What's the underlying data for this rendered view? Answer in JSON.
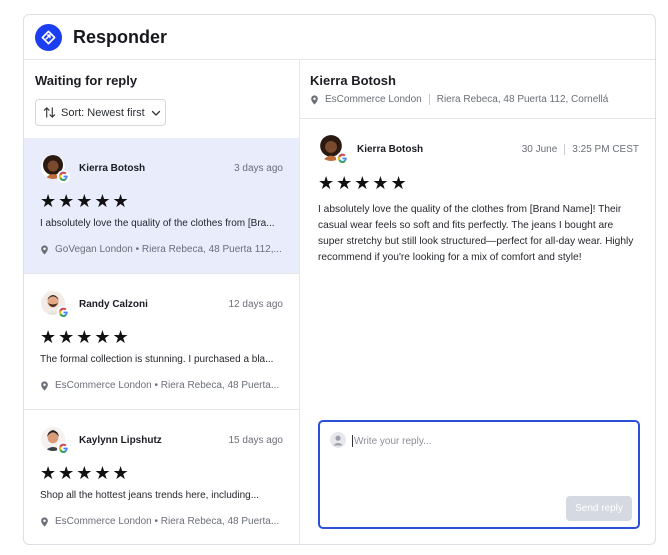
{
  "app": {
    "title": "Responder",
    "accent": "#1a3ef0"
  },
  "left_panel": {
    "title": "Waiting for reply",
    "sort_label": "Sort: Newest first",
    "reviews": [
      {
        "name": "Kierra Botosh",
        "time": "3 days ago",
        "stars": "★★★★★",
        "rating": 5,
        "snippet": "I absolutely love the quality of the clothes from [Bra...",
        "location": "GoVegan London • Riera Rebeca, 48 Puerta 112,...",
        "selected": true
      },
      {
        "name": "Randy Calzoni",
        "time": "12 days ago",
        "stars": "★★★★★",
        "rating": 5,
        "snippet": "The formal collection is stunning. I purchased a bla...",
        "location": "EsCommerce London • Riera Rebeca, 48 Puerta...",
        "selected": false
      },
      {
        "name": "Kaylynn Lipshutz",
        "time": "15 days ago",
        "stars": "★★★★★",
        "rating": 5,
        "snippet": "Shop all the hottest jeans trends here, including...",
        "location": "EsCommerce London • Riera Rebeca, 48 Puerta...",
        "selected": false
      }
    ]
  },
  "detail": {
    "header_name": "Kierra Botosh",
    "location_business": "EsCommerce London",
    "location_address": "Riera Rebeca, 48 Puerta 112, Cornellá",
    "reviewer_name": "Kierra Botosh",
    "date": "30 June",
    "time": "3:25 PM CEST",
    "stars": "★★★★★",
    "rating": 5,
    "text": "I absolutely love the quality of the clothes from [Brand Name]! Their casual wear feels so soft and fits perfectly. The jeans I bought are super stretchy but still look structured—perfect for all-day wear. Highly recommend if you're looking for a mix of comfort and style!"
  },
  "reply": {
    "placeholder": "Write your reply...",
    "send_label": "Send reply"
  }
}
